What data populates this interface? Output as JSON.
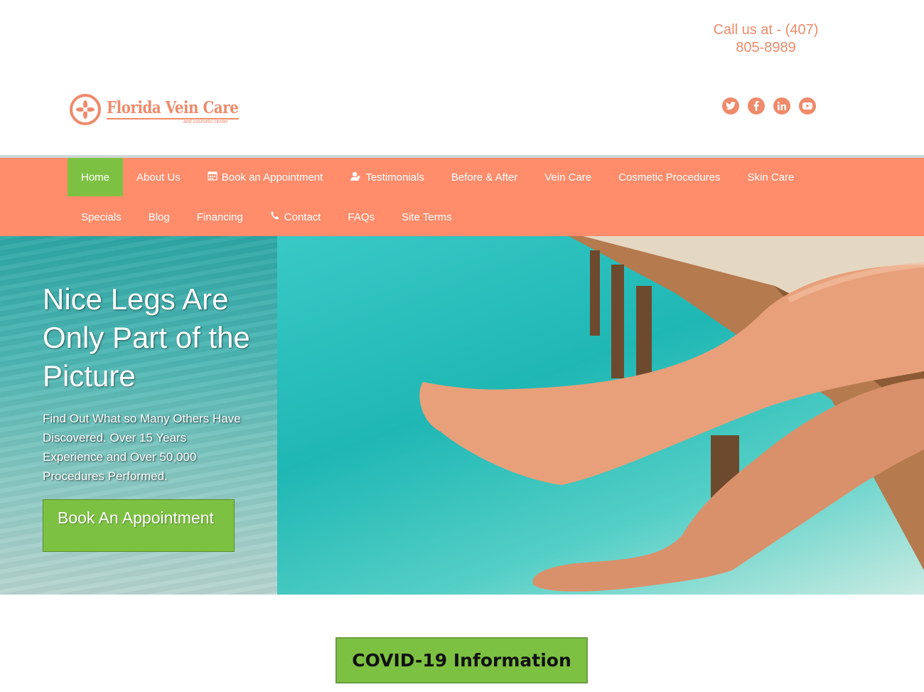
{
  "header": {
    "phone_text": "Call us at - (407) 805-8989",
    "logo": {
      "name": "Florida Vein Care",
      "tagline": "and cosmetic center"
    },
    "social": [
      "twitter-icon",
      "facebook-icon",
      "linkedin-icon",
      "youtube-icon"
    ]
  },
  "nav": {
    "row1": [
      {
        "label": "Home",
        "active": true
      },
      {
        "label": "About Us"
      },
      {
        "label": "Book an Appointment",
        "icon": "calendar-icon"
      },
      {
        "label": "Testimonials",
        "icon": "user-icon"
      },
      {
        "label": "Before & After"
      },
      {
        "label": "Vein Care"
      },
      {
        "label": "Cosmetic Procedures"
      },
      {
        "label": "Skin Care"
      }
    ],
    "row2": [
      {
        "label": "Specials"
      },
      {
        "label": "Blog"
      },
      {
        "label": "Financing"
      },
      {
        "label": "Contact",
        "icon": "phone-icon"
      },
      {
        "label": "FAQs"
      },
      {
        "label": "Site Terms"
      }
    ]
  },
  "hero": {
    "headline": "Nice Legs Are Only Part of the Picture",
    "subtext": "Find Out What so Many Others Have Discovered. Over 15 Years Experience and Over 50,000 Procedures Performed.",
    "button_label": "Book An Appointment"
  },
  "covid_button": "COVID-19 Information",
  "colors": {
    "brand_coral": "#ff8c6b",
    "accent_green": "#7dc142",
    "text_coral": "#ef8a6a"
  }
}
